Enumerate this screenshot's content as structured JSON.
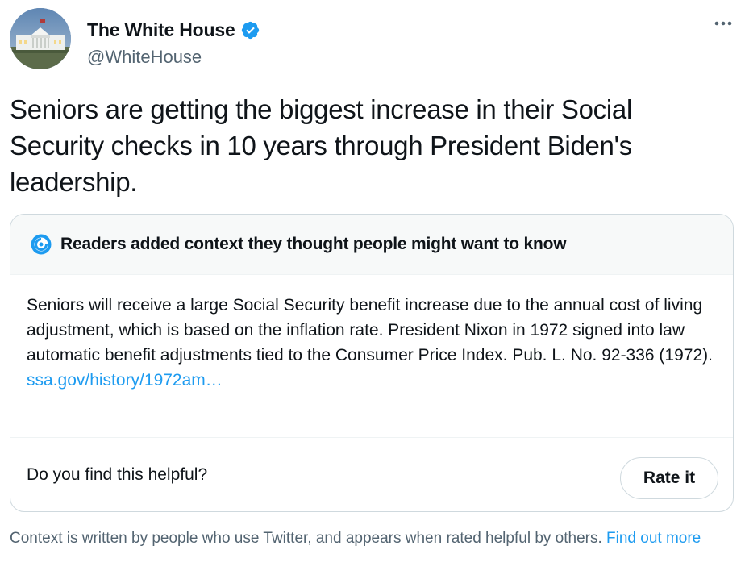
{
  "author": {
    "display_name": "The White House",
    "handle": "@WhiteHouse",
    "verified": true,
    "avatar_icon": "white-house-building-icon"
  },
  "menu_icon": "more-horizontal-icon",
  "tweet": {
    "text": "Seniors are getting the biggest increase in their Social Security checks in 10 years through President Biden's leadership."
  },
  "context_note": {
    "title": "Readers added context they thought people might want to know",
    "icon": "community-notes-icon",
    "body": "Seniors will receive a large Social Security benefit increase due to the annual cost of living adjustment, which is based on the inflation rate. President Nixon in 1972 signed into law automatic benefit adjustments tied to the Consumer Price Index. Pub. L. No. 92-336 (1972).",
    "link": "ssa.gov/history/1972am…",
    "helpful_prompt": "Do you find this helpful?",
    "rate_button": "Rate it"
  },
  "footer": {
    "text": "Context is written by people who use Twitter, and appears when rated helpful by others.",
    "link": "Find out more"
  },
  "colors": {
    "accent": "#1d9bf0",
    "text": "#0f1419",
    "secondary": "#536471",
    "border": "#cfd9de"
  }
}
